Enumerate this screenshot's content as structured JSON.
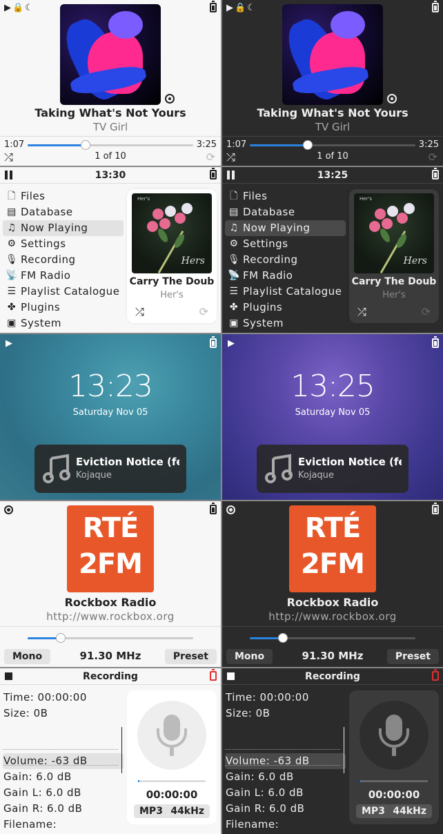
{
  "now_playing": {
    "title": "Taking What's Not Yours",
    "artist": "TV Girl",
    "elapsed": "1:07",
    "total": "3:25",
    "progress": 0.35,
    "position": "1 of 10"
  },
  "menu_light": {
    "time": "13:30",
    "items": [
      "Files",
      "Database",
      "Now Playing",
      "Settings",
      "Recording",
      "FM Radio",
      "Playlist Catalogue",
      "Plugins",
      "System"
    ],
    "selected": "Now Playing",
    "card_title": "Carry The Doub",
    "card_artist": "Her's"
  },
  "menu_dark": {
    "time": "13:25",
    "items": [
      "Files",
      "Database",
      "Now Playing",
      "Settings",
      "Recording",
      "FM Radio",
      "Playlist Catalogue",
      "Plugins",
      "System"
    ],
    "card_title": "Carry The Doub",
    "card_artist": "Her's"
  },
  "lock_light": {
    "time": "13:23",
    "date": "Saturday Nov 05",
    "track": "Eviction Notice (fea",
    "artist": "Kojaque"
  },
  "lock_dark": {
    "time": "13:25",
    "date": "Saturday Nov 05",
    "track": "Eviction Notice (fea",
    "artist": "Kojaque"
  },
  "radio": {
    "logo_line1": "RTÉ",
    "logo_line2": "2FM",
    "title": "Rockbox Radio",
    "url": "http://www.rockbox.org",
    "level": 0.2,
    "mono_label": "Mono",
    "frequency": "91.30 MHz",
    "preset_label": "Preset"
  },
  "recording": {
    "title": "Recording",
    "time_label": "Time: 00:00:00",
    "size_label": "Size: 0B",
    "volume_label": "Volume: -63 dB",
    "gain_label": "Gain: 6.0 dB",
    "gainl_label": "Gain L: 6.0 dB",
    "gainr_label": "Gain R: 6.0 dB",
    "filename_label": "Filename:",
    "timer": "00:00:00",
    "format": "MP3",
    "rate": "44kHz"
  },
  "colors": {
    "accent": "#2a83e0",
    "rte_orange": "#e8572a",
    "record_red": "#e03030"
  },
  "icons": [
    "play-icon",
    "lock-icon",
    "moon-icon",
    "battery-icon",
    "shuffle-icon",
    "repeat-icon",
    "target-icon",
    "pause-icon",
    "file-icon",
    "database-icon",
    "music-note-icon",
    "gear-icon",
    "mic-icon",
    "antenna-icon",
    "playlist-icon",
    "puzzle-icon",
    "system-icon",
    "radio-icon",
    "power-icon",
    "stop-icon"
  ]
}
